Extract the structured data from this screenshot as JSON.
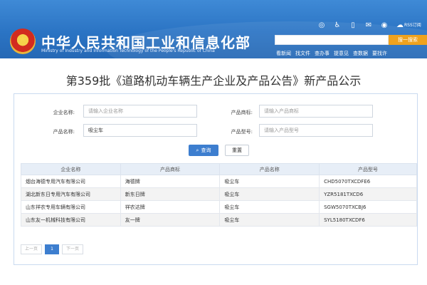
{
  "header": {
    "title": "中华人民共和国工业和信息化部",
    "subtitle": "Ministry of Industry and Information Technology of the People's Republic of China",
    "rss": "RSS订阅",
    "search_button": "搜一搜索",
    "nav": [
      "看新闻",
      "找文件",
      "查办事",
      "提意见",
      "查数据",
      "要找许"
    ],
    "icons": [
      "accessibility-icon",
      "wheelchair-icon",
      "mobile-icon",
      "mail-icon",
      "weibo-icon",
      "wechat-icon"
    ]
  },
  "page": {
    "title": "第359批《道路机动车辆生产企业及产品公告》新产品公示"
  },
  "form": {
    "company_label": "企业名称:",
    "company_placeholder": "请输入企业名称",
    "brand_label": "产品商标:",
    "brand_placeholder": "请输入产品商标",
    "product_label": "产品名称:",
    "product_value": "吸尘车",
    "model_label": "产品型号:",
    "model_placeholder": "请输入产品型号",
    "query_label": "查询",
    "reset_label": "重置"
  },
  "table": {
    "headers": [
      "企业名称",
      "产品商标",
      "产品名称",
      "产品型号"
    ],
    "rows": [
      [
        "烟台海德专用汽车有限公司",
        "海德牌",
        "吸尘车",
        "CHD5070TXCDFE6"
      ],
      [
        "湖北新东日专用汽车有限公司",
        "新东日牌",
        "吸尘车",
        "YZR5181TXCD6"
      ],
      [
        "山东祥农专用车辆有限公司",
        "祥农达牌",
        "吸尘车",
        "SGW5070TXCBJ6"
      ],
      [
        "山东友一机械科技有限公司",
        "友一牌",
        "吸尘车",
        "SYL5180TXCDF6"
      ]
    ]
  },
  "pager": {
    "prev": "上一页",
    "current": "1",
    "next": "下一页"
  },
  "colors": {
    "header_blue": "#2b74c4",
    "accent_orange": "#f0a21d",
    "button_blue": "#3d7ecf"
  }
}
